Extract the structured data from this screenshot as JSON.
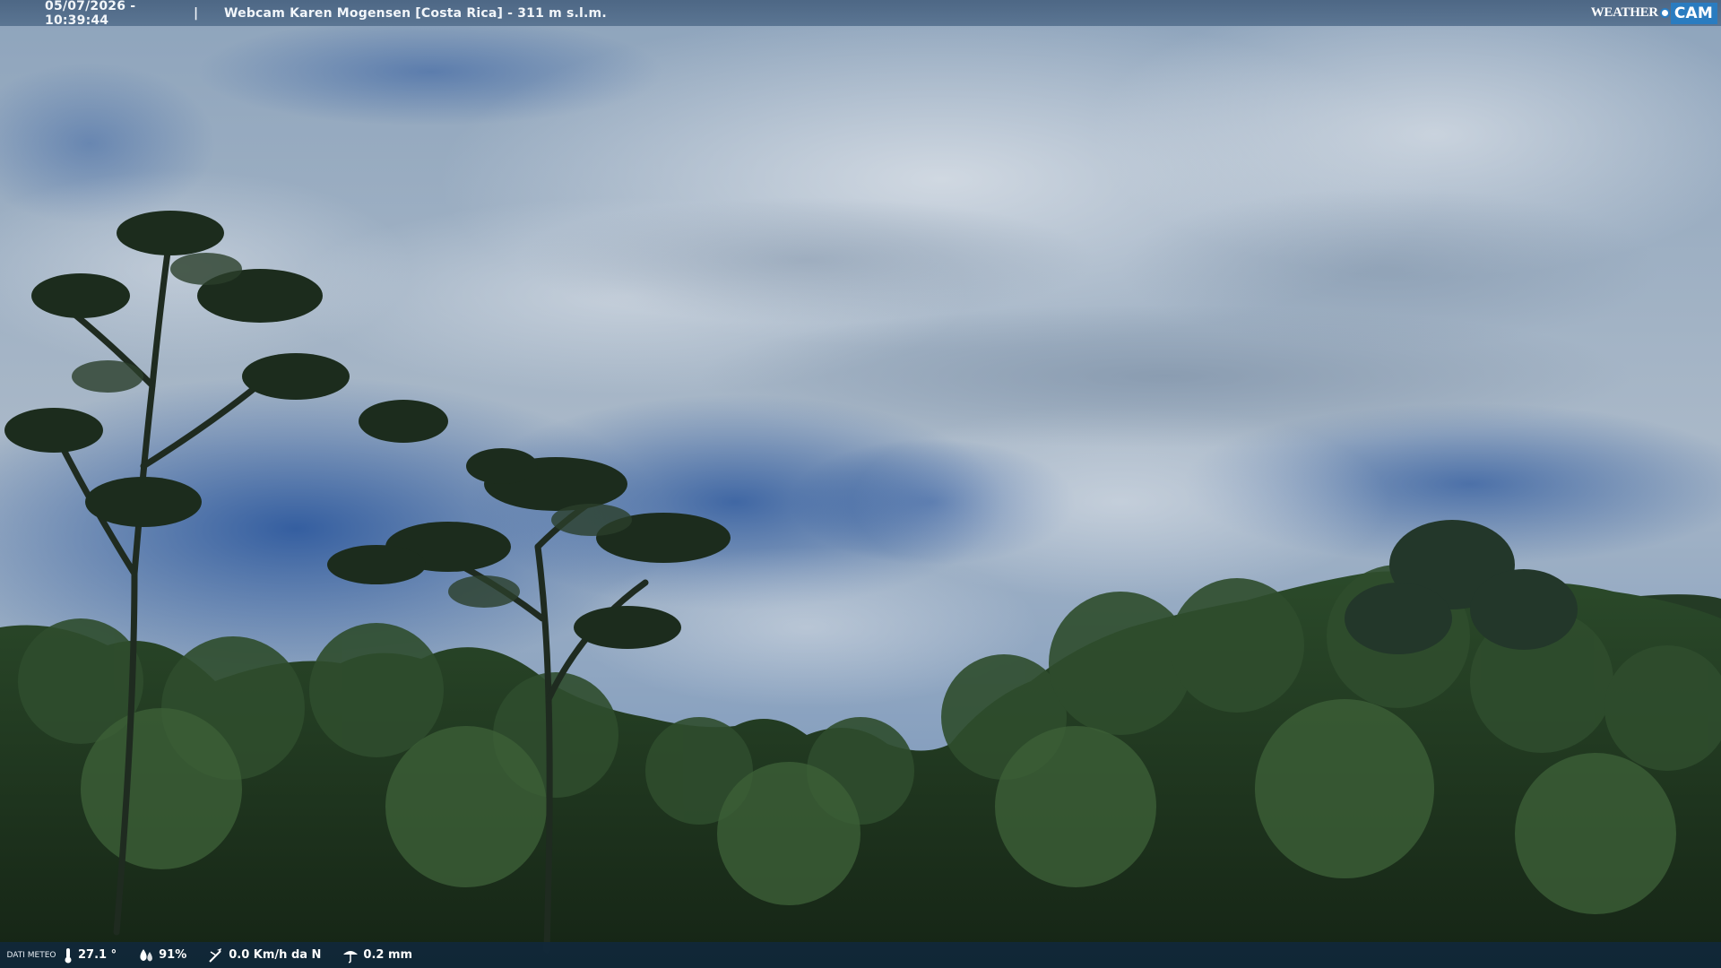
{
  "header": {
    "timestamp": "05/07/2026 - 10:39:44",
    "separator": "|",
    "title": "Webcam Karen Mogensen [Costa Rica]  - 311 m s.l.m."
  },
  "logo": {
    "weather_text": "WEATHER",
    "cam_text": "CAM"
  },
  "weather_bar": {
    "label": "DATI METEO",
    "temperature": "27.1 °",
    "humidity": "91%",
    "wind": "0.0 Km/h da N",
    "rain": "0.2 mm"
  },
  "colors": {
    "sky_blue": "#3f68a8",
    "cloud_light": "#c6d0da",
    "foliage_dark": "#1d2f1e",
    "bar_bottom": "#10283e",
    "logo_blue": "#2a7cc0"
  }
}
